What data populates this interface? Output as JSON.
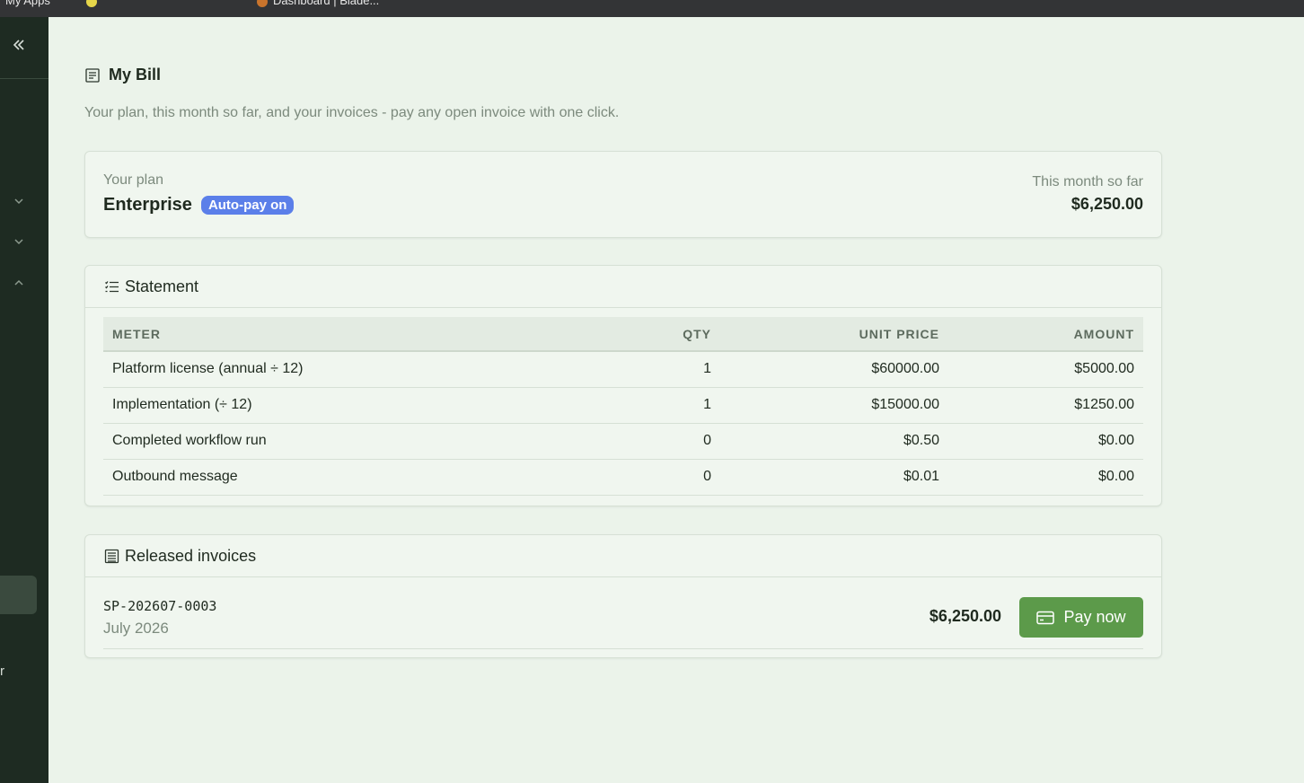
{
  "browser": {
    "bookmarks": [
      {
        "label": "My Apps"
      },
      {
        "label": ""
      },
      {
        "label": "Dashboard | Blade..."
      }
    ]
  },
  "sidebar": {
    "collapse_icon": "double-chevron-left-icon",
    "cut_label": "r"
  },
  "page": {
    "title": "My Bill",
    "subtitle": "Your plan, this month so far, and your invoices - pay any open invoice with one click."
  },
  "plan": {
    "label": "Your plan",
    "name": "Enterprise",
    "badge": "Auto-pay on",
    "month_label": "This month so far",
    "month_total": "$6,250.00"
  },
  "statement": {
    "title": "Statement",
    "columns": {
      "meter": "METER",
      "qty": "QTY",
      "unit_price": "UNIT PRICE",
      "amount": "AMOUNT"
    },
    "rows": [
      {
        "meter": "Platform license (annual ÷ 12)",
        "qty": "1",
        "unit_price": "$60000.00",
        "amount": "$5000.00"
      },
      {
        "meter": "Implementation (÷ 12)",
        "qty": "1",
        "unit_price": "$15000.00",
        "amount": "$1250.00"
      },
      {
        "meter": "Completed workflow run",
        "qty": "0",
        "unit_price": "$0.50",
        "amount": "$0.00"
      },
      {
        "meter": "Outbound message",
        "qty": "0",
        "unit_price": "$0.01",
        "amount": "$0.00"
      }
    ]
  },
  "invoices": {
    "title": "Released invoices",
    "items": [
      {
        "id": "SP-202607-0003",
        "period": "July 2026",
        "amount": "$6,250.00",
        "action": "Pay now"
      }
    ]
  },
  "colors": {
    "sidebar_bg": "#1e2b22",
    "page_bg": "#ebf3ea",
    "badge": "#5b7fe9",
    "pay_button": "#5c9a4a"
  }
}
